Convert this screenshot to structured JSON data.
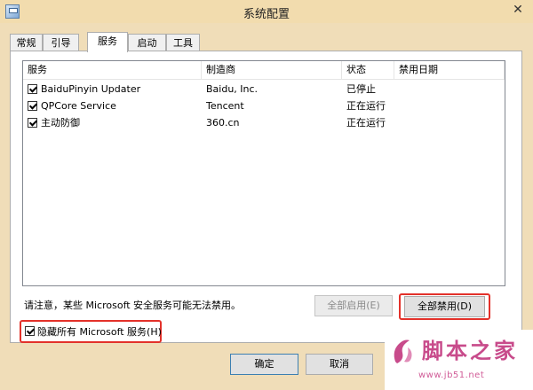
{
  "window": {
    "title": "系统配置"
  },
  "tabs": [
    {
      "label": "常规",
      "active": false
    },
    {
      "label": "引导",
      "active": false
    },
    {
      "label": "服务",
      "active": true
    },
    {
      "label": "启动",
      "active": false
    },
    {
      "label": "工具",
      "active": false
    }
  ],
  "services": {
    "columns": [
      "服务",
      "制造商",
      "状态",
      "禁用日期"
    ],
    "rows": [
      {
        "checked": true,
        "name": "BaiduPinyin Updater",
        "manufacturer": "Baidu, Inc.",
        "status": "已停止",
        "disabled_date": ""
      },
      {
        "checked": true,
        "name": "QPCore Service",
        "manufacturer": "Tencent",
        "status": "正在运行",
        "disabled_date": ""
      },
      {
        "checked": true,
        "name": "主动防御",
        "manufacturer": "360.cn",
        "status": "正在运行",
        "disabled_date": ""
      }
    ]
  },
  "note": "请注意，某些 Microsoft 安全服务可能无法禁用。",
  "buttons": {
    "enable_all": "全部启用(E)",
    "disable_all": "全部禁用(D)",
    "ok": "确定",
    "cancel": "取消"
  },
  "hide_ms": {
    "checked": true,
    "label": "隐藏所有 Microsoft 服务(H)"
  },
  "watermark": {
    "text": "脚本之家",
    "url": "www.jb51.net"
  },
  "colors": {
    "highlight_box": "#e3312a",
    "title_bar": "#f2dcae",
    "watermark": "#c84b8b"
  }
}
